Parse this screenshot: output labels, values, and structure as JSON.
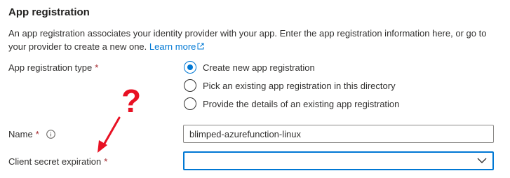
{
  "section": {
    "title": "App registration",
    "description": "An app registration associates your identity provider with your app. Enter the app registration information here, or go to your provider to create a new one.",
    "learn_more": "Learn more"
  },
  "fields": {
    "registration_type": {
      "label": "App registration type",
      "required_mark": "*",
      "options": [
        {
          "label": "Create new app registration",
          "selected": true
        },
        {
          "label": "Pick an existing app registration in this directory",
          "selected": false
        },
        {
          "label": "Provide the details of an existing app registration",
          "selected": false
        }
      ]
    },
    "name": {
      "label": "Name",
      "required_mark": "*",
      "value": "blimped-azurefunction-linux"
    },
    "client_secret_expiration": {
      "label": "Client secret expiration",
      "required_mark": "*",
      "value": ""
    }
  },
  "annotation": {
    "symbol": "?",
    "color": "#e81123"
  },
  "colors": {
    "accent": "#0078d4",
    "required": "#a4262c",
    "text": "#323130"
  },
  "icons": [
    "external-link-icon",
    "info-icon",
    "chevron-down-icon",
    "radio-selected-icon",
    "arrow-annotation-icon"
  ]
}
